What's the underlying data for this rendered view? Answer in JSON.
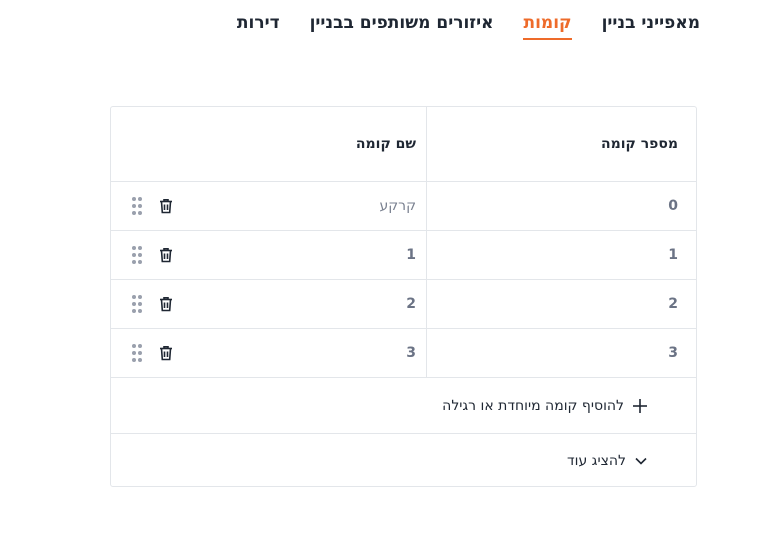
{
  "tabs": [
    {
      "label": "מאפייני בניין",
      "active": false
    },
    {
      "label": "קומות",
      "active": true
    },
    {
      "label": "איזורים משותפים בבניין",
      "active": false
    },
    {
      "label": "דירות",
      "active": false
    }
  ],
  "table": {
    "headers": {
      "floor_number": "מספר קומה",
      "floor_name": "שם קומה"
    },
    "rows": [
      {
        "floor_number": "0",
        "floor_name": "קרקע"
      },
      {
        "floor_number": "1",
        "floor_name": "1"
      },
      {
        "floor_number": "2",
        "floor_name": "2"
      },
      {
        "floor_number": "3",
        "floor_name": "3"
      }
    ]
  },
  "actions": {
    "add_floor_label": "להוסיף קומה מיוחדת או רגילה",
    "show_more_label": "להציג עוד"
  },
  "colors": {
    "accent": "#ee6b2a",
    "text": "#1f2733",
    "muted": "#6b7385",
    "border": "#e3e6ea"
  },
  "icons": {
    "drag": "drag-handle-icon",
    "delete": "trash-icon",
    "add": "plus-icon",
    "expand": "chevron-down-icon"
  }
}
